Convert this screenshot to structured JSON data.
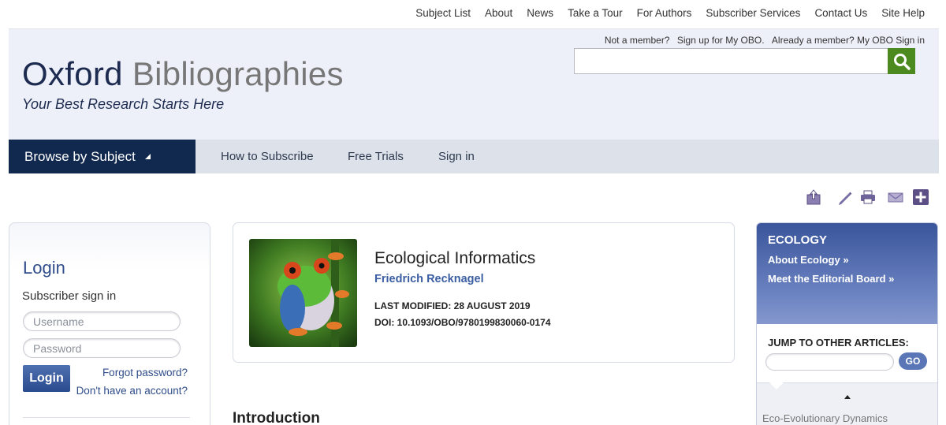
{
  "topnav": [
    "Subject List",
    "About",
    "News",
    "Take a Tour",
    "For Authors",
    "Subscriber Services",
    "Contact Us",
    "Site Help"
  ],
  "member": {
    "not_member": "Not a member?",
    "signup": "Sign up for My OBO.",
    "already": "Already a member? My OBO Sign in"
  },
  "logo": {
    "oxford": "Oxford",
    "bibliographies": "Bibliographies",
    "tagline": "Your Best Research Starts Here"
  },
  "search": {
    "placeholder": "",
    "button_icon": "search-icon"
  },
  "nav": {
    "browse": "Browse by Subject",
    "subscribe": "How to Subscribe",
    "trials": "Free Trials",
    "signin": "Sign in"
  },
  "tools": [
    "share-icon",
    "pencil-icon",
    "print-icon",
    "email-icon",
    "plus-icon"
  ],
  "login": {
    "title": "Login",
    "subtitle": "Subscriber sign in",
    "username_placeholder": "Username",
    "password_placeholder": "Password",
    "button": "Login",
    "forgot": "Forgot password?",
    "no_account": "Don't have an account?"
  },
  "article": {
    "title": "Ecological Informatics",
    "author": "Friedrich Recknagel",
    "modified": "LAST MODIFIED: 28 AUGUST 2019",
    "doi": "DOI: 10.1093/OBO/9780199830060-0174"
  },
  "main": {
    "section_heading": "Introduction"
  },
  "sidebar": {
    "title": "ECOLOGY",
    "about": "About Ecology »",
    "board": "Meet the Editorial Board »",
    "jump_label": "JUMP TO OTHER ARTICLES:",
    "go": "GO",
    "list_item": "Eco-Evolutionary Dynamics"
  },
  "colors": {
    "navy": "#11294f",
    "accent_green": "#4c8a1f",
    "link_blue": "#3b5da2"
  }
}
